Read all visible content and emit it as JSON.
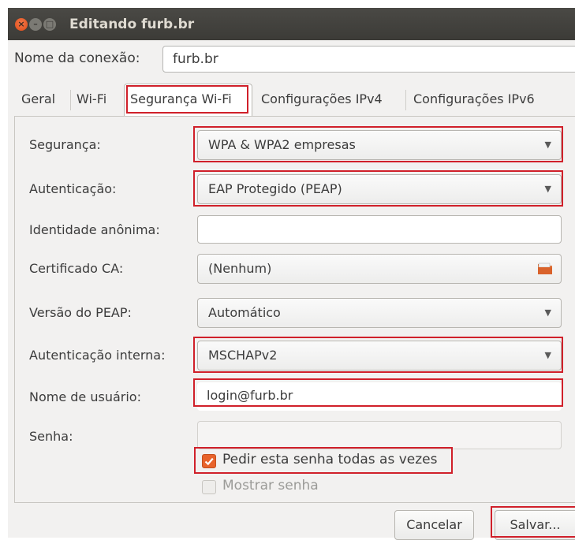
{
  "window": {
    "title": "Editando furb.br",
    "close_glyph": "×",
    "min_glyph": "–",
    "max_glyph": "□"
  },
  "connection": {
    "name_label": "Nome da conexão:",
    "name_value": "furb.br"
  },
  "tabs": [
    {
      "label": "Geral"
    },
    {
      "label": "Wi-Fi"
    },
    {
      "label": "Segurança Wi-Fi",
      "active": true
    },
    {
      "label": "Configurações IPv4"
    },
    {
      "label": "Configurações IPv6"
    }
  ],
  "form": {
    "security_label": "Segurança:",
    "security_value": "WPA & WPA2 empresas",
    "auth_label": "Autenticação:",
    "auth_value": "EAP Protegido (PEAP)",
    "anon_label": "Identidade anônima:",
    "anon_value": "",
    "ca_label": "Certificado CA:",
    "ca_value": "(Nenhum)",
    "peap_label": "Versão do PEAP:",
    "peap_value": "Automático",
    "inner_label": "Autenticação interna:",
    "inner_value": "MSCHAPv2",
    "user_label": "Nome de usuário:",
    "user_value": "login@furb.br",
    "password_label": "Senha:",
    "password_value": ""
  },
  "options": {
    "ask_password_label": "Pedir esta senha todas as vezes",
    "ask_password_checked": true,
    "show_password_label": "Mostrar senha",
    "show_password_checked": false
  },
  "buttons": {
    "cancel": "Cancelar",
    "save": "Salvar..."
  },
  "colors": {
    "highlight": "#d0202a",
    "accent": "#e8632b",
    "titlebar": "#3c3b37"
  },
  "icons": {
    "dropdown": "▼",
    "folder": "folder-icon"
  }
}
